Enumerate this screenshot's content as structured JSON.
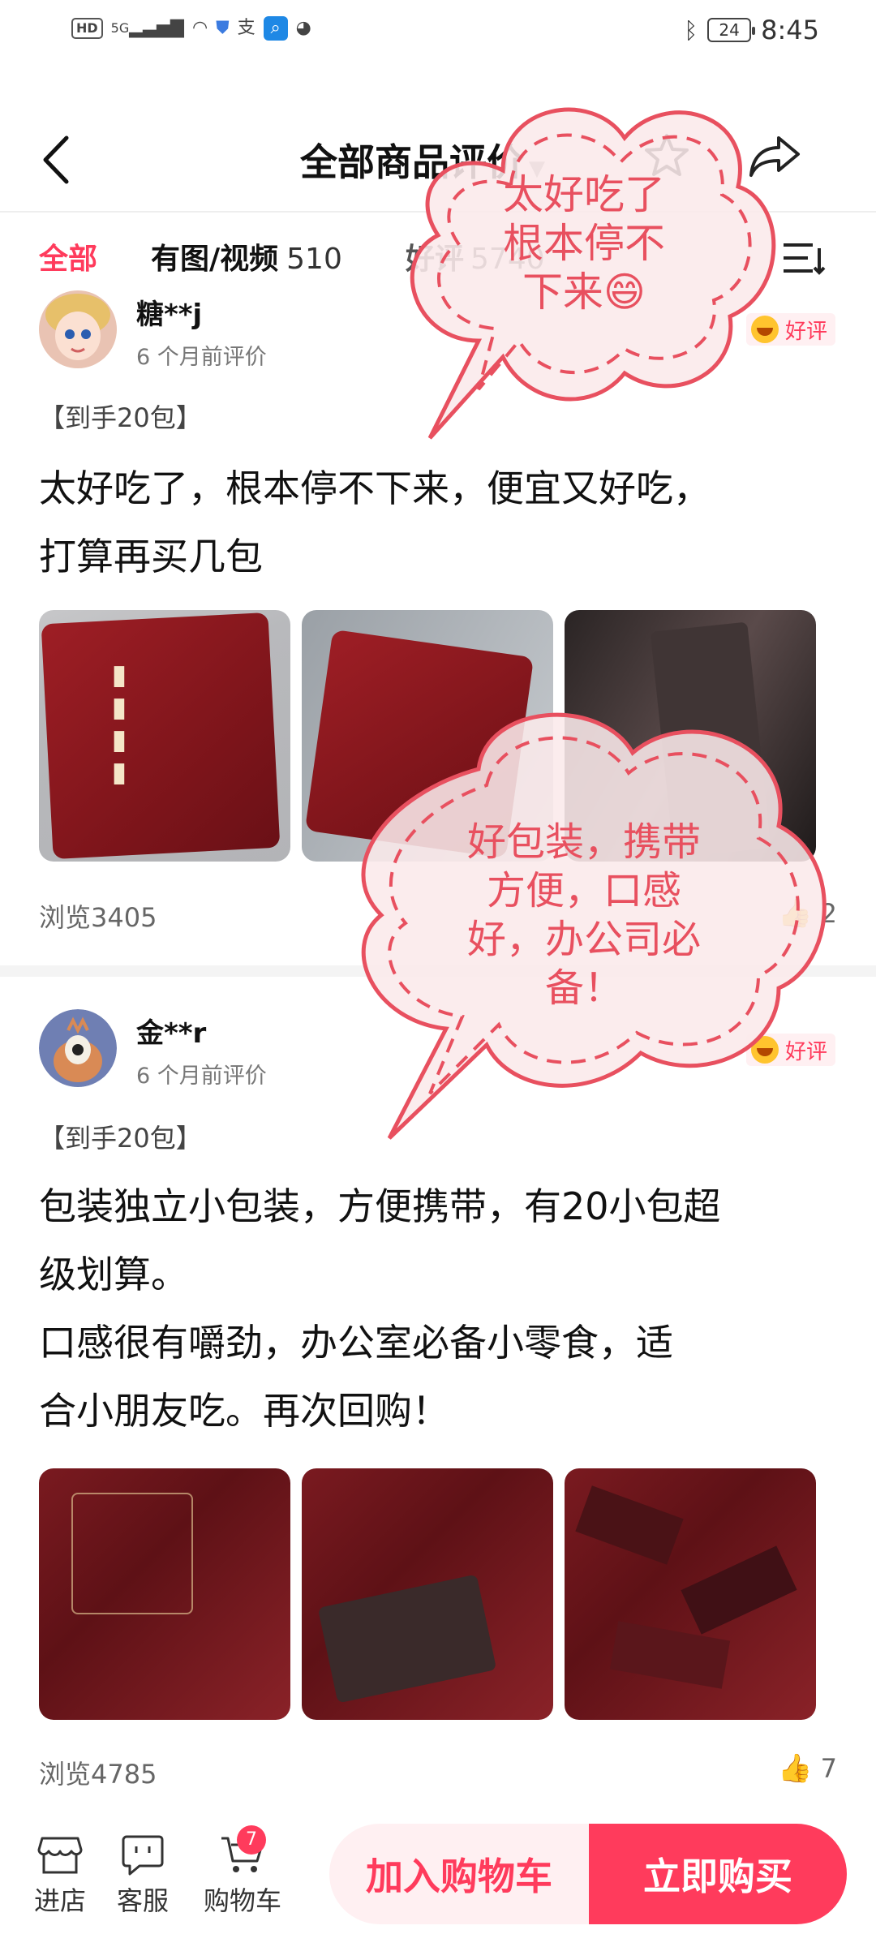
{
  "status_bar": {
    "time": "8:45",
    "battery": "24",
    "network": "5G",
    "hd_label": "HD",
    "alipay_glyph": "支"
  },
  "header": {
    "title": "全部商品评价",
    "back_icon": "back-arrow-icon",
    "favorite_icon": "star-icon",
    "share_icon": "share-icon"
  },
  "tabs": [
    {
      "label": "全部",
      "count": ""
    },
    {
      "label": "有图/视频",
      "count": "510"
    },
    {
      "label": "好评",
      "count": "5740"
    }
  ],
  "reviews": [
    {
      "user": "糖**j",
      "time": "6 个月前评价",
      "rating": "好评",
      "spec": "【到手20包】",
      "text": "太好吃了，根本停不下来，便宜又好吃，\n打算再买几包",
      "views": "浏览3405",
      "likes": "2"
    },
    {
      "user": "金**r",
      "time": "6 个月前评价",
      "rating": "好评",
      "spec": "【到手20包】",
      "text": "包装独立小包装，方便携带，有20小包超\n级划算。\n 口感很有嚼劲，办公室必备小零食，适\n合小朋友吃。再次回购！",
      "views": "浏览4785",
      "likes": "7"
    }
  ],
  "bubbles": [
    {
      "text": "太好吃了\n根本停不\n下来😄"
    },
    {
      "text": "好包装，携带\n方便，口感\n好，办公司必\n备！"
    }
  ],
  "bottom_bar": {
    "store_label": "进店",
    "service_label": "客服",
    "cart_label": "购物车",
    "cart_count": "7",
    "add_to_cart": "加入购物车",
    "buy_now": "立即购买"
  },
  "colors": {
    "accent": "#ff3b5c",
    "bubble_red": "#e8505f",
    "bubble_fill": "#fbe9ea"
  }
}
